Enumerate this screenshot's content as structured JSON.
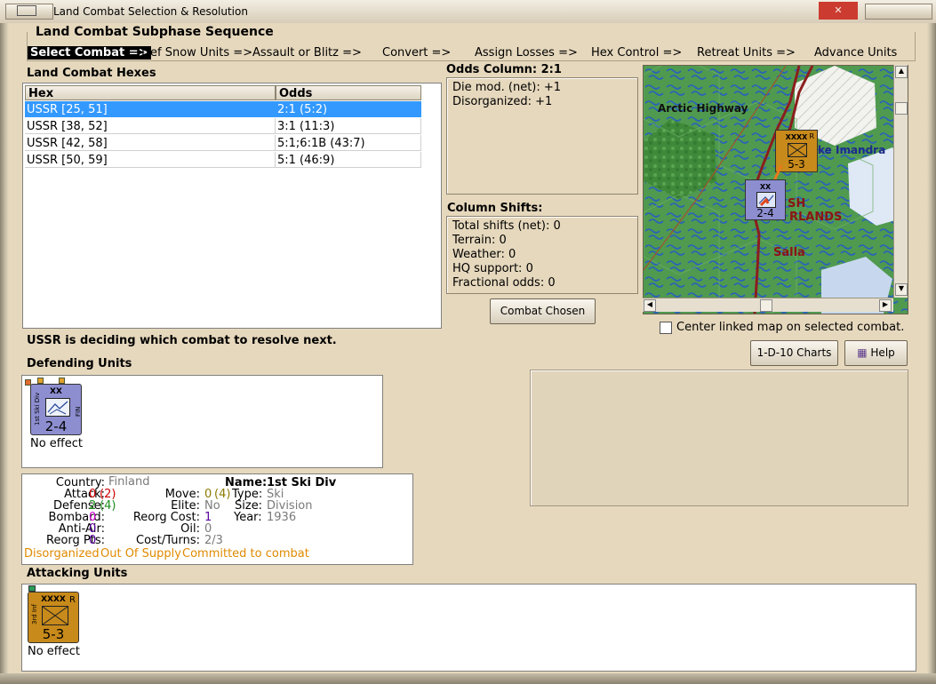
{
  "window": {
    "title": "Land Combat Selection & Resolution",
    "close_glyph": "✕"
  },
  "subphase": {
    "title": "Land Combat Subphase Sequence",
    "steps": [
      "Select Combat =>",
      "Def Snow Units =>",
      "Assault or Blitz =>",
      "Convert =>",
      "Assign Losses =>",
      "Hex Control =>",
      "Retreat Units =>",
      "Advance Units"
    ]
  },
  "hexes": {
    "title": "Land Combat Hexes",
    "columns": [
      "Hex",
      "Odds"
    ],
    "rows": [
      [
        "USSR [25, 51]",
        "2:1 (5:2)"
      ],
      [
        "USSR [38, 52]",
        "3:1 (11:3)"
      ],
      [
        "USSR [42, 58]",
        "5:1;6:1B (43:7)"
      ],
      [
        "USSR [50, 59]",
        "5:1 (46:9)"
      ]
    ]
  },
  "odds": {
    "title": "Odds Column: 2:1",
    "lines": [
      "Die mod. (net): +1",
      "Disorganized: +1"
    ]
  },
  "shifts": {
    "title": "Column Shifts:",
    "lines": [
      "Total shifts (net): 0",
      "Terrain: 0",
      "Weather: 0",
      "HQ support: 0",
      "Fractional odds: 0"
    ]
  },
  "buttons": {
    "combat_chosen": "Combat Chosen",
    "charts": "1-D-10 Charts",
    "help": "Help"
  },
  "center_map_label": "Center linked map on selected combat.",
  "status": "USSR is deciding which combat to resolve next.",
  "defending": {
    "title": "Defending Units",
    "unit": {
      "size": "XX",
      "side": "1st Ski Div",
      "nation": "FIN",
      "strength": "2-4",
      "result": "No effect"
    }
  },
  "details": {
    "country_label": "Country:",
    "country": "Finland",
    "name_label": "Name:",
    "name": "1st Ski Div",
    "attack_label": "Attack:",
    "attack": "0",
    "attack_alt": "(2)",
    "move_label": "Move:",
    "move": "0",
    "move_alt": "(4)",
    "type_label": "Type:",
    "type": "Ski",
    "defense_label": "Defense:",
    "defense": "2",
    "defense_alt": "(4)",
    "elite_label": "Elite:",
    "elite": "No",
    "size_label": "Size:",
    "size": "Division",
    "bombard_label": "Bombard:",
    "bombard": "0",
    "reorg_cost_label": "Reorg Cost:",
    "reorg_cost": "1",
    "year_label": "Year:",
    "year": "1936",
    "antiair_label": "Anti-Air:",
    "antiair": "0",
    "oil_label": "Oil:",
    "oil": "0",
    "reorg_pts_label": "Reorg Pts:",
    "reorg_pts": "0",
    "cost_turns_label": "Cost/Turns:",
    "cost_turns": "2/3",
    "flags": [
      "Disorganized",
      "Out Of Supply",
      "Committed to combat"
    ]
  },
  "attacking": {
    "title": "Attacking Units",
    "unit": {
      "size": "XXXX",
      "side": "3rd Inf",
      "corner": "R",
      "strength": "5-3",
      "result": "No effect"
    }
  },
  "map": {
    "labels": [
      "Arctic Highway",
      "ke Imandra",
      "SH",
      "RLANDS",
      "Salla"
    ],
    "map_counter_attacker": {
      "size": "XXXX",
      "corner": "R",
      "strength": "5-3"
    },
    "map_counter_defender": {
      "size": "XX",
      "strength": "2-4"
    }
  },
  "colors": {
    "selection": "#3399ff",
    "attacker_counter": "#c88a1a",
    "defender_counter": "#8d8ed0",
    "red_value": "#cc0000",
    "green_value": "#1e8c1e",
    "olive_value": "#8c7a00",
    "magenta_value": "#cc00cc",
    "purple_value": "#5a00a0",
    "grey_value": "#7a7a7a",
    "orange_flag": "#e08a00"
  }
}
